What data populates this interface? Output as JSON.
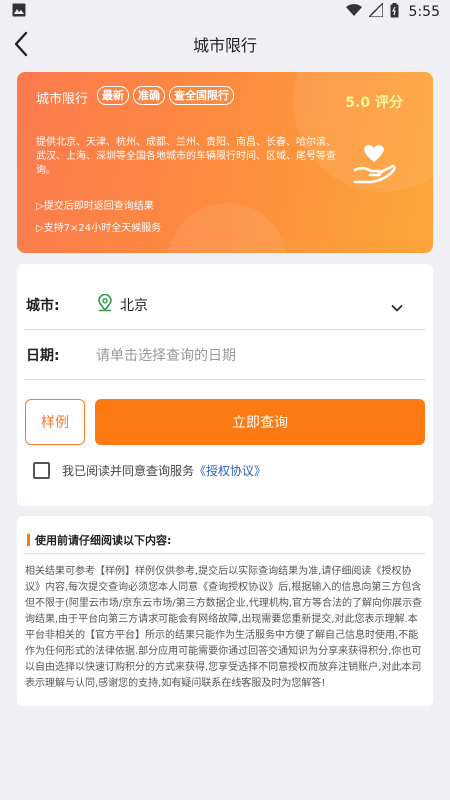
{
  "statusbar": {
    "time": "5:55"
  },
  "navbar": {
    "title": "城市限行"
  },
  "banner": {
    "title": "城市限行",
    "chips": [
      "最新",
      "准确",
      "查全国限行"
    ],
    "rating": "5.0 评分",
    "description": "提供北京、天津、杭州、成都、兰州、贵阳、南昌、长春、哈尔滨、武汉、上海、深圳等全国各地城市的车辆限行时间、区域、尾号等查询。",
    "feature1": "▷提交后即时返回查询结果",
    "feature2": "▷支持7×24小时全天候服务"
  },
  "form": {
    "city_label": "城市:",
    "city_value": "北京",
    "date_label": "日期:",
    "date_placeholder": "请单击选择查询的日期",
    "sample_button": "样例",
    "query_button": "立即查询",
    "agree_text": "我已阅读并同意查询服务",
    "agree_link": "《授权协议》"
  },
  "notice": {
    "title": "使用前请仔细阅读以下内容:",
    "body": "相关结果可参考【样例】样例仅供参考,提交后以实际查询结果为准,请仔细阅读《授权协议》内容,每次提交查询必须您本人同意《查询授权协议》后,根据输入的信息向第三方包含但不限于(阿里云市场/京东云市场/第三方数据企业,代理机构,官方等合法的了解向你展示查询结果,由于平台向第三方请求可能会有网络故障,出现需要您重新提交,对此您表示理解.本平台非相关的【官方平台】所示的结果只能作为生活服务中方便了解自己信息时使用,不能作为任何形式的法律依据.部分应用可能需要你通过回答交通知识为分享来获得积分,你也可以自由选择以快速订购积分的方式来获得,您享受选择不同意授权而放弃注销账户,对此本司表示理解与认同,感谢您的支持,如有疑问联系在线客服及时为您解答!"
  },
  "colors": {
    "accent": "#fd7a12",
    "link": "#2a62c9",
    "rating": "#fff8a0"
  }
}
